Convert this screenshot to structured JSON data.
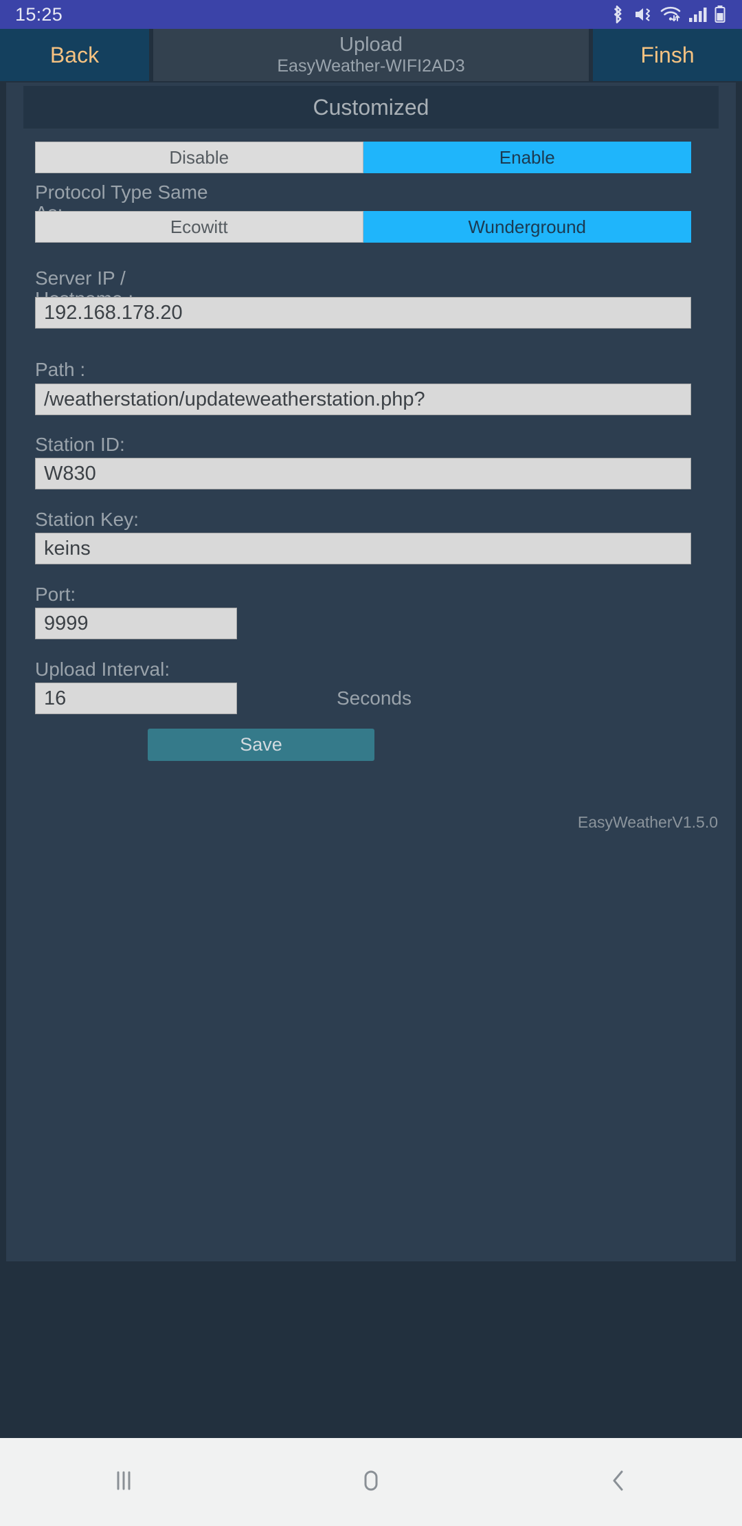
{
  "status_bar": {
    "time": "15:25",
    "icons": [
      "bluetooth-icon",
      "volume-mute-icon",
      "wifi-icon",
      "signal-icon",
      "battery-icon"
    ]
  },
  "nav_bar": {
    "back_label": "Back",
    "finish_label": "Finsh",
    "title_main": "Upload",
    "title_sub": "EasyWeather-WIFI2AD3"
  },
  "card": {
    "header_title": "Customized",
    "version": "EasyWeatherV1.5.0",
    "save_label": "Save"
  },
  "enable_toggle": {
    "options": [
      "Disable",
      "Enable"
    ],
    "selected": "Enable"
  },
  "protocol_toggle": {
    "label": "Protocol Type Same\nAs:",
    "options": [
      "Ecowitt",
      "Wunderground"
    ],
    "selected": "Wunderground"
  },
  "fields": {
    "server": {
      "label": "Server IP /\nHostname :",
      "value": "192.168.178.20"
    },
    "path": {
      "label": "Path :",
      "value": "/weatherstation/updateweatherstation.php?"
    },
    "station_id": {
      "label": "Station ID:",
      "value": "W830"
    },
    "station_key": {
      "label": "Station Key:",
      "value": "keins"
    },
    "port": {
      "label": "Port:",
      "value": "9999"
    },
    "interval": {
      "label": "Upload Interval:",
      "value": "16",
      "unit": "Seconds"
    }
  },
  "system_nav": {
    "recents": "recents-icon",
    "home": "home-icon",
    "back": "back-icon"
  },
  "colors": {
    "status_bar": "#3B43A8",
    "accent_cyan": "#1FB5FB",
    "action_text": "#F6C281",
    "card": "#2D3E50",
    "page": "#22303E",
    "save": "#357A8A"
  }
}
